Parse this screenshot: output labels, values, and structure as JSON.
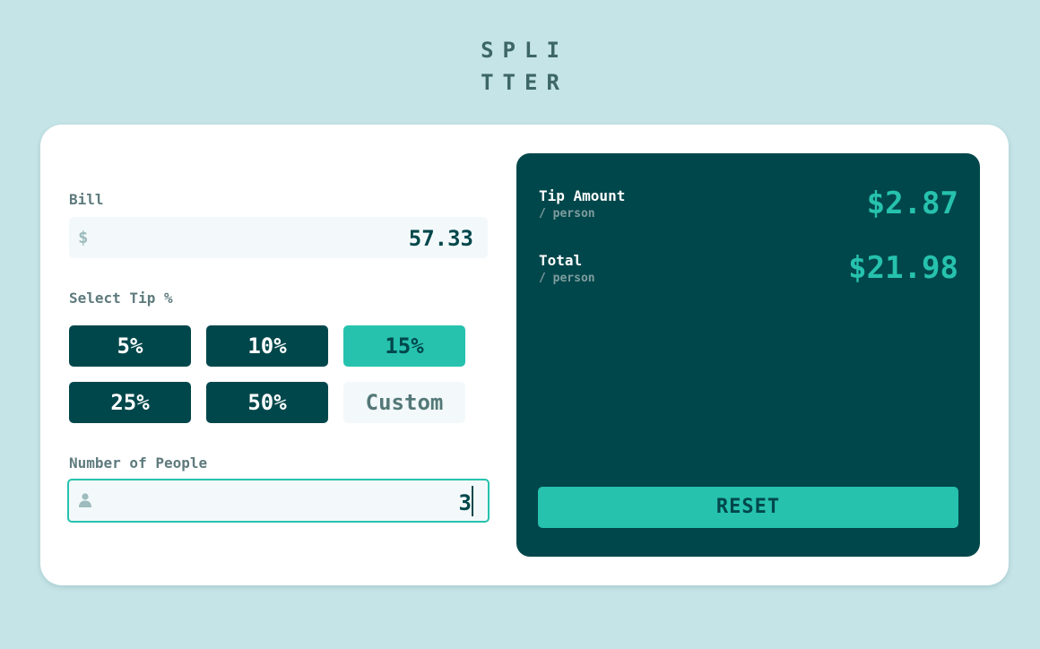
{
  "logo": {
    "line1": "SPLI",
    "line2": "TTER"
  },
  "bill": {
    "label": "Bill",
    "prefix": "$",
    "value": "57.33"
  },
  "tip": {
    "label": "Select Tip %",
    "options": [
      "5%",
      "10%",
      "15%",
      "25%",
      "50%"
    ],
    "selected": "15%",
    "custom_placeholder": "Custom"
  },
  "people": {
    "label": "Number of People",
    "value": "3"
  },
  "results": {
    "tip_amount": {
      "label": "Tip Amount",
      "sub": "/ person",
      "value": "$2.87"
    },
    "total": {
      "label": "Total",
      "sub": "/ person",
      "value": "$21.98"
    },
    "reset_label": "RESET"
  },
  "colors": {
    "background": "#c5e4e7",
    "card": "#ffffff",
    "panel": "#00474b",
    "accent": "#26c2ae",
    "input_bg": "#f3f9fa"
  },
  "icons": {
    "bill_prefix": "dollar-icon",
    "people_prefix": "person-icon"
  }
}
